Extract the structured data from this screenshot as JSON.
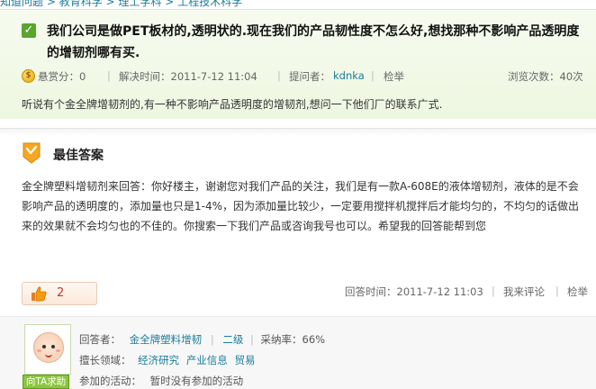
{
  "breadcrumb": [
    "知道问题",
    "教育科学",
    "理工学科",
    "工程技术科学"
  ],
  "question": {
    "title": "我们公司是做PET板材的,透明状的.现在我们的产品韧性度不怎么好,想找那种不影响产品透明度的增韧剂哪有买.",
    "reward_label": "悬赏分：0",
    "solved_time": "解决时间：2011-7-12 11:04",
    "asker_label": "提问者：",
    "asker": "kdnka",
    "report": "检举",
    "views": "浏览次数：40次",
    "description": "听说有个金全牌增韧剂的,有一种不影响产品透明度的增韧剂,想问一下他们厂的联系广式."
  },
  "best_answer": {
    "heading": "最佳答案",
    "text": "金全牌塑料增韧剂来回答：你好楼主，谢谢您对我们产品的关注，我们是有一款A-608E的液体增韧剂，液体的是不会影响产品的透明度的，添加量也只是1-4%，因为添加量比较少，一定要用搅拌机搅拌后才能均匀的，不均匀的话做出来的效果就不会均匀也的不佳的。你搜索一下我们产品或咨询我号也可以。希望我的回答能帮到您",
    "likes": "2",
    "answer_time": "回答时间：2011-7-12 11:03",
    "comment": "我来评论",
    "report": "检举"
  },
  "answerer": {
    "label": "回答者：",
    "name": "金全牌塑料增韧",
    "level": "二级",
    "adopt_rate": "采纳率：66%",
    "field_label": "擅长领域：",
    "fields": [
      "经济研究",
      "产业信息",
      "贸易"
    ],
    "activity_label": "参加的活动：",
    "activity": "暂时没有参加的活动",
    "ask_button": "向TA求助"
  },
  "colors": {
    "accent": "#5aa52d",
    "link": "#1a7c9c",
    "like": "#c0392b"
  }
}
